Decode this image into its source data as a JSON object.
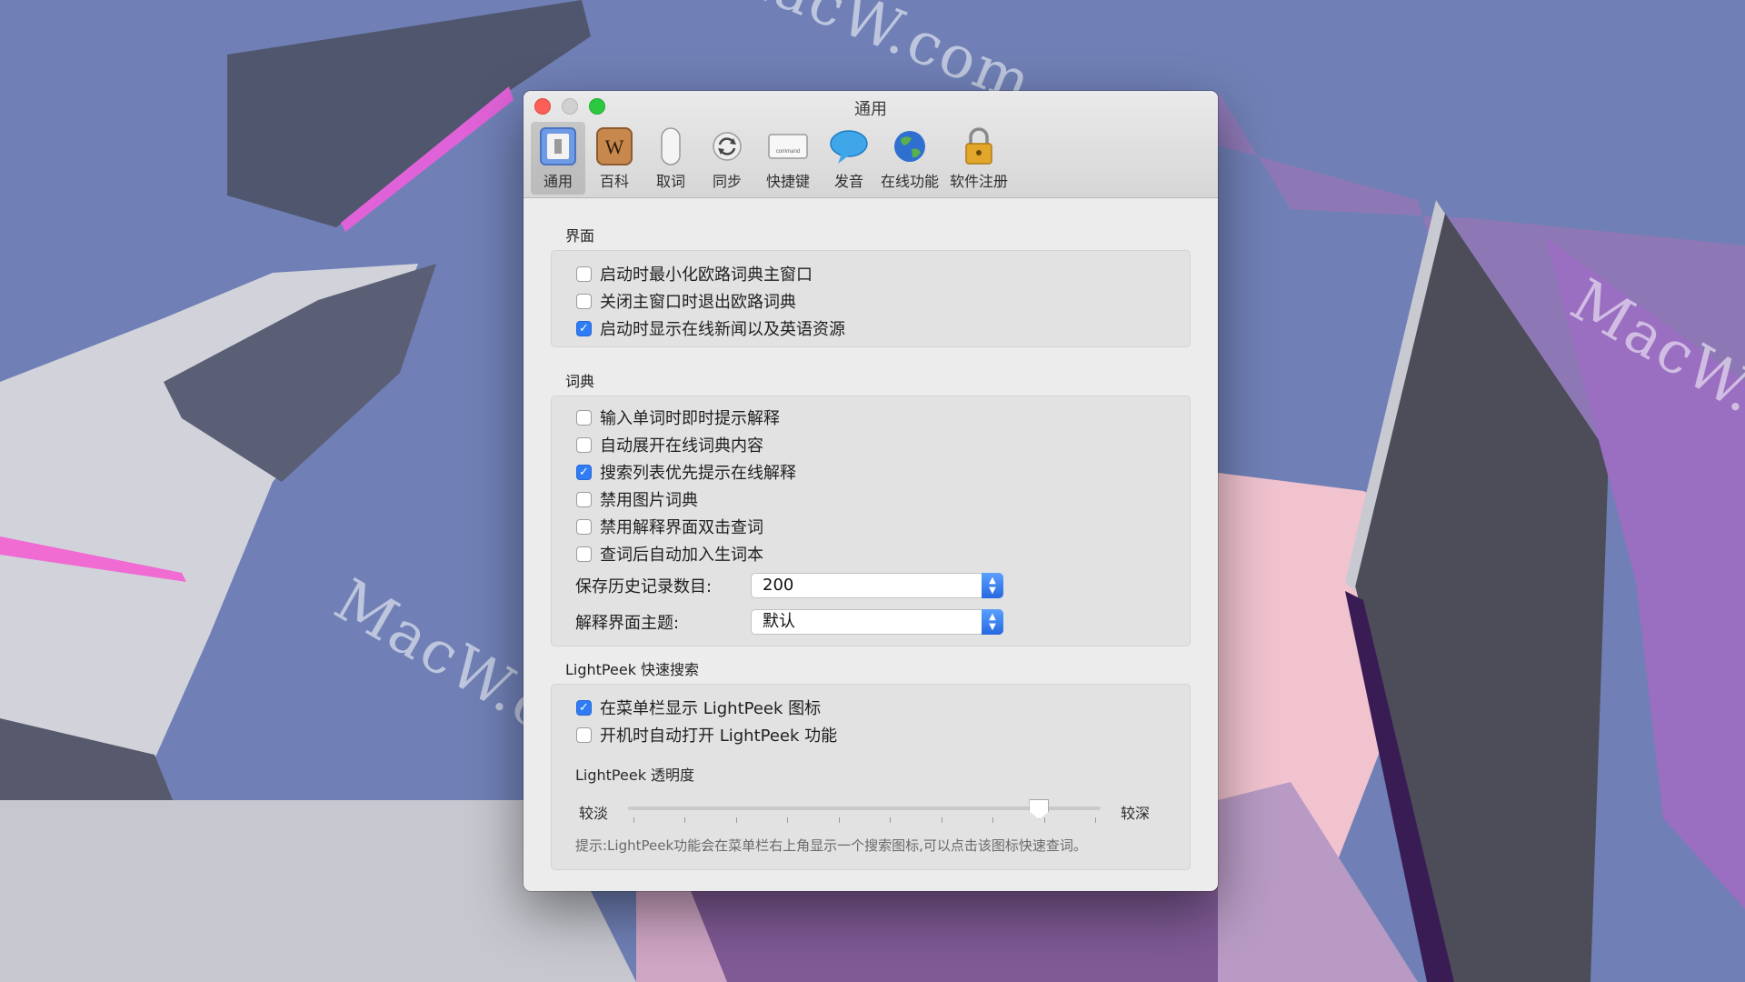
{
  "window": {
    "title": "通用"
  },
  "toolbar": [
    {
      "label": "通用",
      "icon": "switch-icon",
      "selected": true
    },
    {
      "label": "百科",
      "icon": "wiki-icon",
      "selected": false
    },
    {
      "label": "取词",
      "icon": "mouse-icon",
      "selected": false
    },
    {
      "label": "同步",
      "icon": "sync-icon",
      "selected": false
    },
    {
      "label": "快捷键",
      "icon": "keyboard-key-icon",
      "selected": false
    },
    {
      "label": "发音",
      "icon": "speech-bubble-icon",
      "selected": false
    },
    {
      "label": "在线功能",
      "icon": "globe-icon",
      "selected": false
    },
    {
      "label": "软件注册",
      "icon": "padlock-icon",
      "selected": false
    }
  ],
  "keycap_text": "command",
  "wiki_letter": "W",
  "interface": {
    "title": "界面",
    "options": [
      {
        "label": "启动时最小化欧路词典主窗口",
        "checked": false
      },
      {
        "label": "关闭主窗口时退出欧路词典",
        "checked": false
      },
      {
        "label": "启动时显示在线新闻以及英语资源",
        "checked": true
      }
    ]
  },
  "dictionary": {
    "title": "词典",
    "options": [
      {
        "label": "输入单词时即时提示解释",
        "checked": false
      },
      {
        "label": "自动展开在线词典内容",
        "checked": false
      },
      {
        "label": "搜索列表优先提示在线解释",
        "checked": true
      },
      {
        "label": "禁用图片词典",
        "checked": false
      },
      {
        "label": "禁用解释界面双击查词",
        "checked": false
      },
      {
        "label": "查词后自动加入生词本",
        "checked": false
      }
    ],
    "history_label": "保存历史记录数目:",
    "history_value": "200",
    "theme_label": "解释界面主题:",
    "theme_value": "默认"
  },
  "lightpeek": {
    "title": "LightPeek 快速搜索",
    "options": [
      {
        "label": "在菜单栏显示 LightPeek 图标",
        "checked": true
      },
      {
        "label": "开机时自动打开 LightPeek 功能",
        "checked": false
      }
    ],
    "slider_caption": "LightPeek 透明度",
    "slider_min_label": "较淡",
    "slider_max_label": "较深",
    "slider_value": 0.87,
    "tick_count": 10,
    "hint": "提示:LightPeek功能会在菜单栏右上角显示一个搜索图标,可以点击该图标快速查词。"
  },
  "watermark": "MacW.com",
  "colors": {
    "accent": "#2f7cf6",
    "close": "#fc5f57",
    "maximize": "#2bc840"
  }
}
